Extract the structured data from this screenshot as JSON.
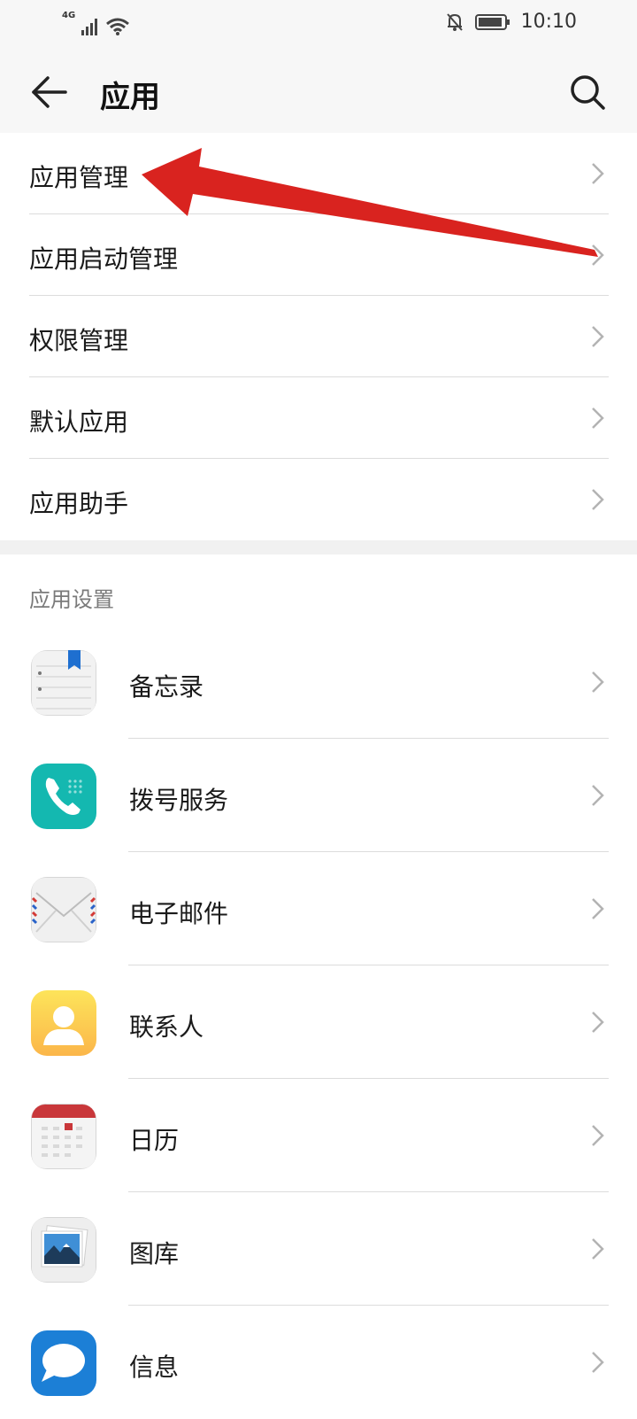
{
  "status_bar": {
    "network": "4G",
    "time": "10:10",
    "icons": [
      "signal-icon",
      "wifi-icon",
      "mute-icon",
      "battery-icon"
    ]
  },
  "header": {
    "title": "应用",
    "back_icon": "back-arrow-icon",
    "search_icon": "search-icon"
  },
  "menu": {
    "items": [
      {
        "label": "应用管理"
      },
      {
        "label": "应用启动管理"
      },
      {
        "label": "权限管理"
      },
      {
        "label": "默认应用"
      },
      {
        "label": "应用助手"
      }
    ]
  },
  "section": {
    "title": "应用设置"
  },
  "apps": {
    "items": [
      {
        "label": "备忘录",
        "icon": "notepad-icon"
      },
      {
        "label": "拨号服务",
        "icon": "phone-icon"
      },
      {
        "label": "电子邮件",
        "icon": "email-icon"
      },
      {
        "label": "联系人",
        "icon": "contacts-icon"
      },
      {
        "label": "日历",
        "icon": "calendar-icon"
      },
      {
        "label": "图库",
        "icon": "gallery-icon"
      },
      {
        "label": "信息",
        "icon": "messages-icon"
      }
    ]
  },
  "colors": {
    "annotation_arrow": "#d9231f",
    "chevron": "#b3b3b3",
    "divider": "#dcdcdc",
    "dialer": "#14b8b0",
    "messages": "#1c7fd6"
  }
}
